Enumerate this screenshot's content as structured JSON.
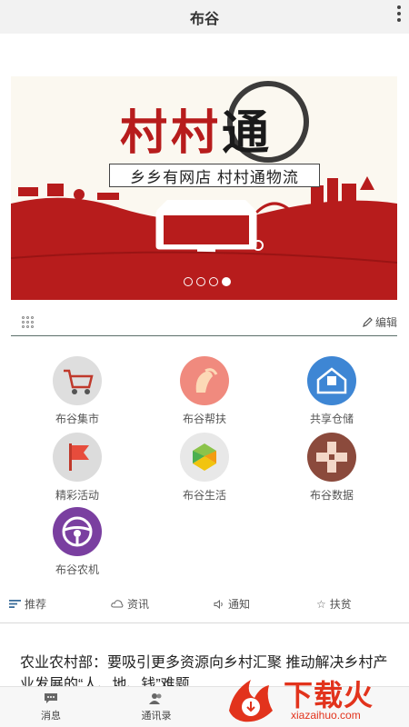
{
  "titlebar": {
    "title": "布谷"
  },
  "banner": {
    "brand": "村村",
    "brand_tong": "通",
    "slogan": "乡乡有网店 村村通物流",
    "slide_count": 4,
    "active_slide": 4
  },
  "editrow": {
    "edit_label": "编辑"
  },
  "functions": [
    {
      "label": "布谷集市",
      "icon": "shopping-cart-icon",
      "color": "#d9d9d9"
    },
    {
      "label": "布谷帮扶",
      "icon": "helping-hand-icon",
      "color": "#f08a7e"
    },
    {
      "label": "共享仓储",
      "icon": "warehouse-icon",
      "color": "#3e86d4"
    },
    {
      "label": "精彩活动",
      "icon": "flag-icon",
      "color": "#dcdcdc"
    },
    {
      "label": "布谷生活",
      "icon": "life-logo-icon",
      "color": "#e8e8e8"
    },
    {
      "label": "布谷数据",
      "icon": "data-logo-icon",
      "color": "#8b4a3c"
    },
    {
      "label": "布谷农机",
      "icon": "steering-wheel-icon",
      "color": "#7a3fa0"
    }
  ],
  "tabs": [
    {
      "label": "推荐",
      "icon": "list-icon"
    },
    {
      "label": "资讯",
      "icon": "cloud-icon"
    },
    {
      "label": "通知",
      "icon": "speaker-icon"
    },
    {
      "label": "扶贫",
      "icon": "star-icon"
    }
  ],
  "news": {
    "headline": "农业农村部：要吸引更多资源向乡村汇聚 推动解决乡村产业发展的“人、地、钱”难题"
  },
  "bottomnav": [
    {
      "label": "消息",
      "icon": "message-icon"
    },
    {
      "label": "通讯录",
      "icon": "contacts-icon"
    }
  ],
  "watermark": {
    "text": "下载火",
    "url": "xiazaihuo.com"
  },
  "colors": {
    "banner_red": "#b71c1c",
    "accent_line": "#5b6f6a"
  }
}
